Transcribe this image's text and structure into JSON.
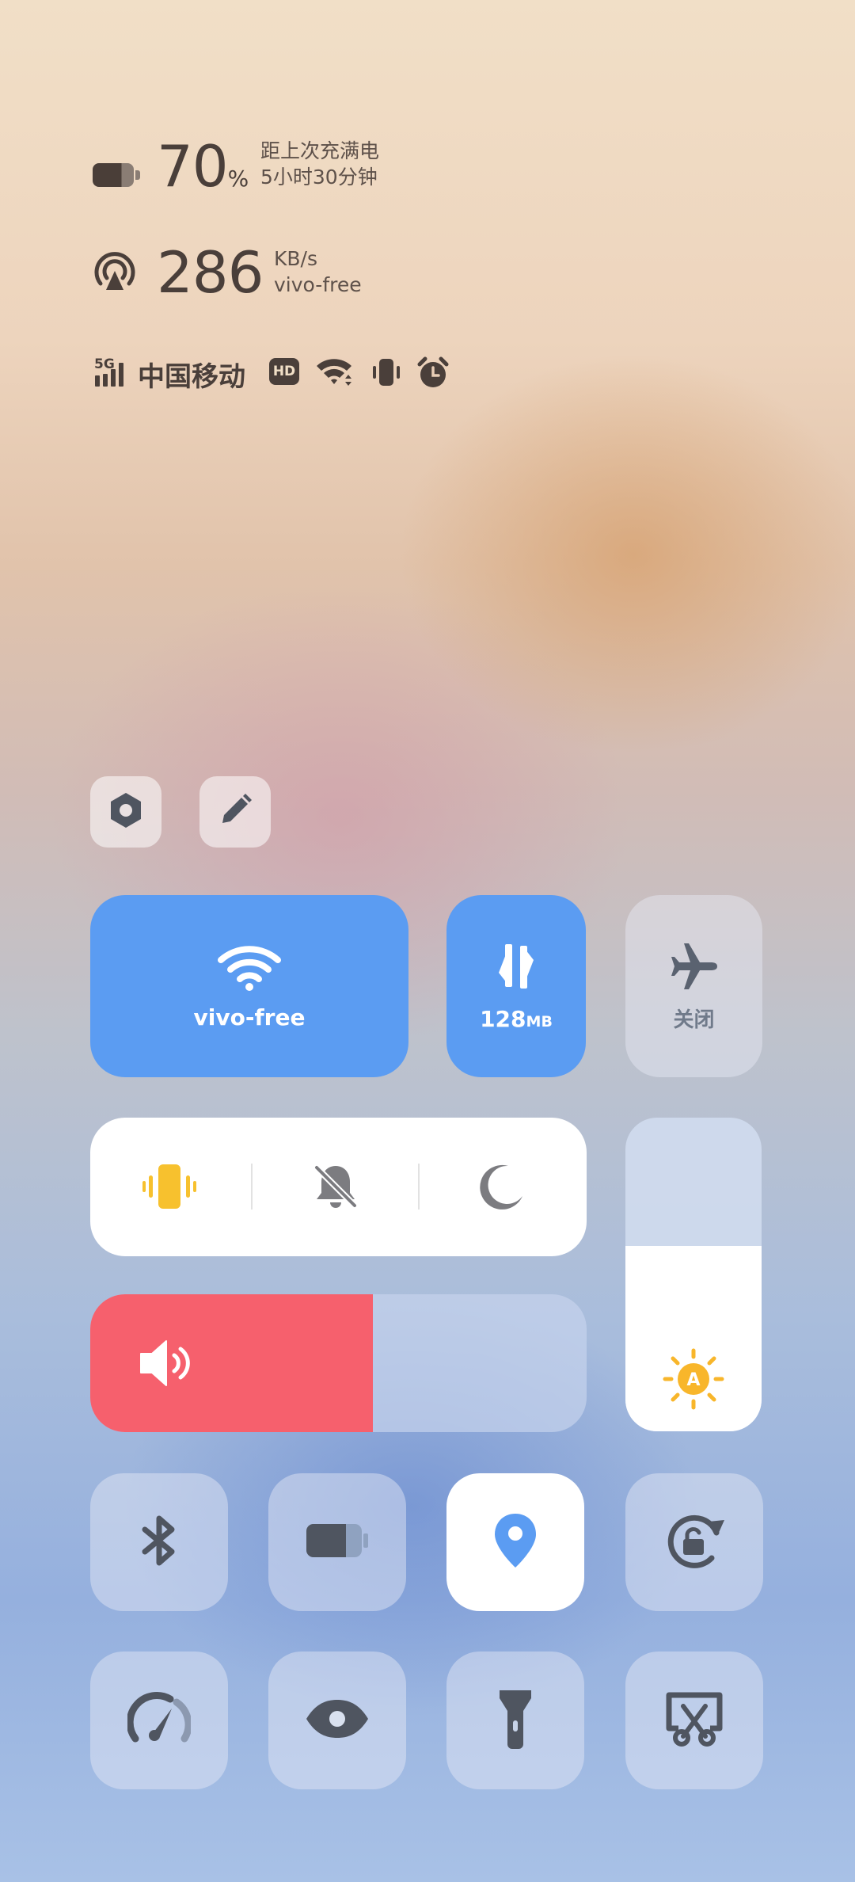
{
  "battery": {
    "percent": "70",
    "percent_unit": "%",
    "since_label": "距上次充满电",
    "duration": "5小时30分钟",
    "level": 0.7
  },
  "network": {
    "speed": "286",
    "unit": "KB/s",
    "ssid": "vivo-free"
  },
  "status_bar": {
    "signal_type": "5G",
    "carrier": "中国移动",
    "hd_badge": "HD",
    "icons": [
      "signal-5g-icon",
      "hd-icon",
      "wifi-icon",
      "vibrate-icon",
      "alarm-icon"
    ]
  },
  "top_buttons": [
    {
      "icon": "settings-icon"
    },
    {
      "icon": "edit-icon"
    }
  ],
  "tiles": {
    "wifi": {
      "label": "vivo-free",
      "icon": "wifi-icon",
      "active": true
    },
    "data": {
      "value": "128",
      "unit": "MB",
      "icon": "data-transfer-icon",
      "active": true
    },
    "airplane": {
      "label": "关闭",
      "icon": "airplane-icon",
      "active": false
    }
  },
  "ringer": {
    "modes": [
      "vibrate",
      "mute",
      "do-not-disturb"
    ],
    "active": "vibrate"
  },
  "volume": {
    "level": 0.57
  },
  "brightness": {
    "level": 0.59,
    "mode": "A"
  },
  "quick_toggles": [
    {
      "name": "bluetooth",
      "active": false
    },
    {
      "name": "battery-saver",
      "active": false
    },
    {
      "name": "location",
      "active": true
    },
    {
      "name": "rotation-lock",
      "active": false
    },
    {
      "name": "performance",
      "active": false
    },
    {
      "name": "eye-protection",
      "active": false
    },
    {
      "name": "flashlight",
      "active": false
    },
    {
      "name": "screenshot",
      "active": false
    }
  ],
  "colors": {
    "accent_blue": "#5b9cf2",
    "volume_red": "#f6606d",
    "ringer_yellow": "#f7c12e",
    "sun_yellow": "#f8b62b"
  }
}
